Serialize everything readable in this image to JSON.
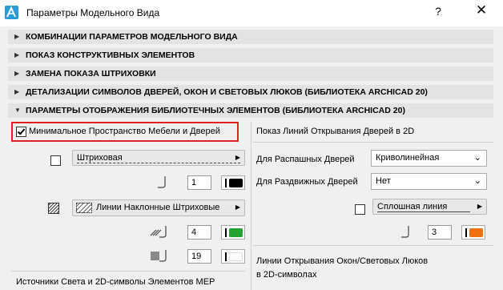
{
  "window": {
    "title": "Параметры Модельного Вида",
    "help_label": "?",
    "close_label": "✕"
  },
  "sections": [
    {
      "label": "КОМБИНАЦИИ ПАРАМЕТРОВ МОДЕЛЬНОГО ВИДА",
      "expanded": false
    },
    {
      "label": "ПОКАЗ КОНСТРУКТИВНЫХ ЭЛЕМЕНТОВ",
      "expanded": false
    },
    {
      "label": "ЗАМЕНА ПОКАЗА ШТРИХОВКИ",
      "expanded": false
    },
    {
      "label": "ДЕТАЛИЗАЦИИ СИМВОЛОВ ДВЕРЕЙ, ОКОН И СВЕТОВЫХ ЛЮКОВ (БИБЛИОТЕКА ARCHICAD 20)",
      "expanded": false
    },
    {
      "label": "ПАРАМЕТРЫ ОТОБРАЖЕНИЯ БИБЛИОТЕЧНЫХ ЭЛЕМЕНТОВ (БИБЛИОТЕКА ARCHICAD 20)",
      "expanded": true
    }
  ],
  "left_panel": {
    "min_space_label": "Минимальное Пространство Мебели и Дверей",
    "min_space_checked": true,
    "line_type": "Штриховая",
    "line_pen": "1",
    "fill_type": "Линии Наклонные Штриховые",
    "fill_pen": "4",
    "bg_pen": "19",
    "footer_label": "Источники Света и 2D-символы Элементов MEP"
  },
  "right_panel": {
    "title": "Показ Линий Открывания Дверей в 2D",
    "swing_label": "Для Распашных Дверей",
    "swing_value": "Криволинейная",
    "sliding_label": "Для Раздвижных Дверей",
    "sliding_value": "Нет",
    "line_type": "Сплошная линия",
    "line_pen": "3",
    "footer_line1": "Линии Открывания Окон/Световых Люков",
    "footer_line2": "в 2D-символах"
  },
  "colors": {
    "pen_1": "#000000",
    "pen_4": "#22a332",
    "pen_19": "#ffffff",
    "pen_3": "#f07010",
    "highlight": "#e02020"
  }
}
